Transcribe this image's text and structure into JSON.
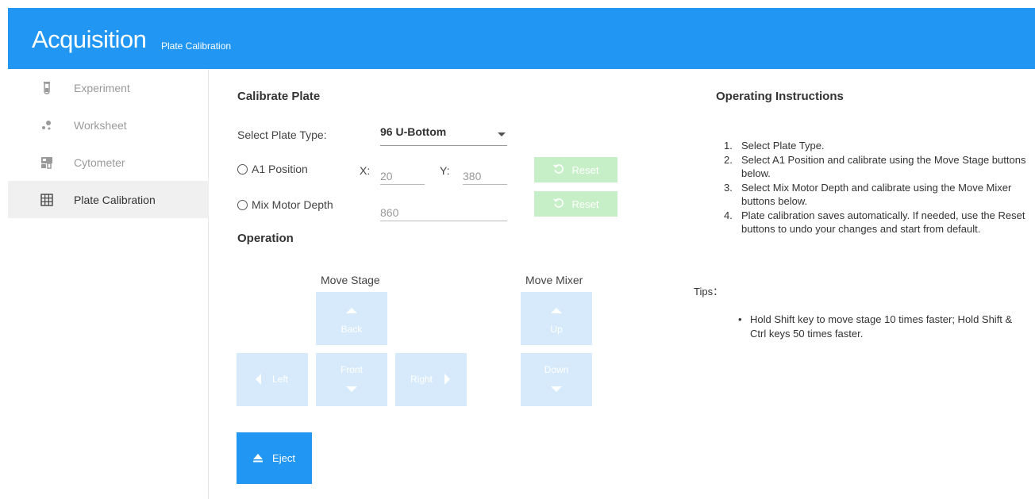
{
  "header": {
    "title": "Acquisition",
    "subtitle": "Plate Calibration",
    "color": "#2196f3"
  },
  "sidebar": {
    "items": [
      {
        "label": "Experiment",
        "icon": "test-tube-icon",
        "active": false
      },
      {
        "label": "Worksheet",
        "icon": "dots-icon",
        "active": false
      },
      {
        "label": "Cytometer",
        "icon": "cytometer-icon",
        "active": false
      },
      {
        "label": "Plate Calibration",
        "icon": "grid-icon",
        "active": true
      }
    ]
  },
  "calibrate": {
    "title": "Calibrate Plate",
    "plate_type_label": "Select Plate Type:",
    "plate_type_value": "96 U-Bottom",
    "a1_label": "A1 Position",
    "x_label": "X:",
    "x_value": "20",
    "y_label": "Y:",
    "y_value": "380",
    "mix_label": "Mix Motor Depth",
    "mix_value": "860",
    "reset_label": "Reset"
  },
  "operation": {
    "title": "Operation",
    "move_stage_label": "Move Stage",
    "move_mixer_label": "Move Mixer",
    "back_label": "Back",
    "front_label": "Front",
    "left_label": "Left",
    "right_label": "Right",
    "up_label": "Up",
    "down_label": "Down",
    "eject_label": "Eject"
  },
  "instructions": {
    "title": "Operating Instructions",
    "steps": [
      "Select Plate Type.",
      "Select A1 Position and calibrate using the Move Stage buttons below.",
      "Select Mix Motor Depth and calibrate using the Move Mixer buttons below.",
      "Plate calibration saves automatically. If needed, use the Reset buttons to undo your changes and start from default."
    ],
    "tips_label": "Tips：",
    "tips": [
      "Hold Shift key to move stage 10 times faster;  Hold Shift & Ctrl keys 50 times faster."
    ]
  }
}
